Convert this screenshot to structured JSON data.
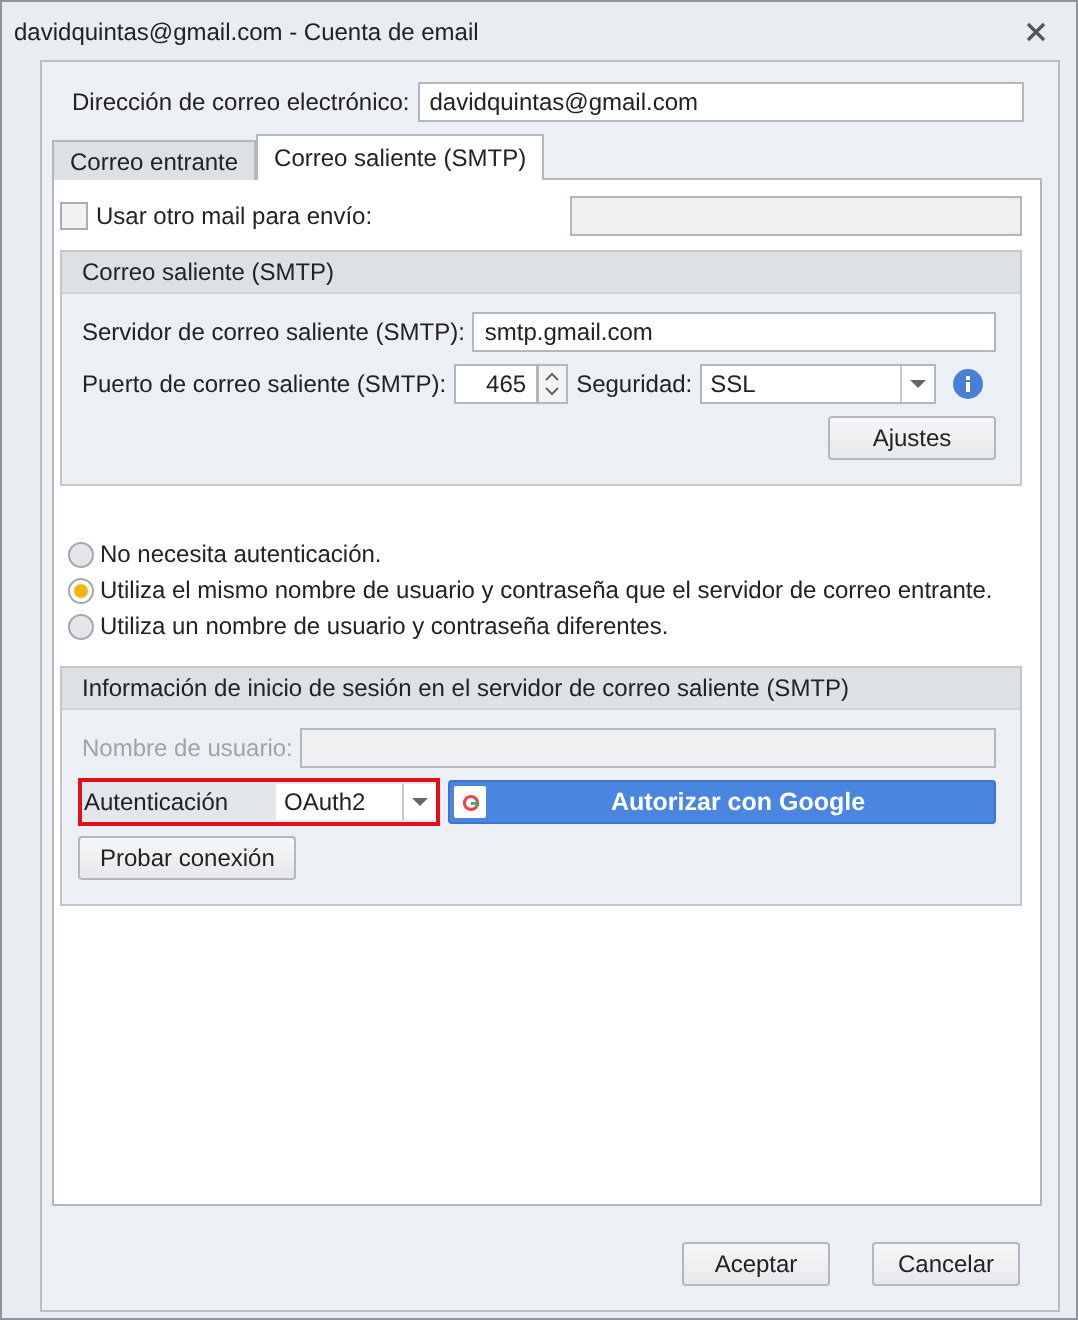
{
  "window": {
    "title": "davidquintas@gmail.com - Cuenta de email"
  },
  "email": {
    "label": "Dirección de correo electrónico:",
    "value": "davidquintas@gmail.com"
  },
  "tabs": [
    {
      "label": "Correo entrante",
      "selected": false
    },
    {
      "label": "Correo saliente (SMTP)",
      "selected": true
    }
  ],
  "alt_mail": {
    "label": "Usar otro mail para envío:",
    "checked": false,
    "disabled": true
  },
  "smtp_group": {
    "title": "Correo saliente (SMTP)",
    "server_label": "Servidor de correo saliente (SMTP):",
    "server": "smtp.gmail.com",
    "port_label": "Puerto de correo saliente (SMTP):",
    "port": "465",
    "security_label": "Seguridad:",
    "security": "SSL",
    "settings_button": "Ajustes"
  },
  "auth_options": [
    {
      "label": "No necesita autenticación.",
      "selected": false
    },
    {
      "label": "Utiliza el mismo nombre de usuario y contraseña que el servidor de correo entrante.",
      "selected": true
    },
    {
      "label": "Utiliza un nombre de usuario y contraseña diferentes.",
      "selected": false
    }
  ],
  "login_group": {
    "title": "Información de inicio de sesión en el servidor de correo saliente (SMTP)",
    "user_label": "Nombre de usuario:",
    "user_disabled": true,
    "auth_label": "Autenticación",
    "auth_value": "OAuth2",
    "auth_highlighted": true,
    "google_button": "Autorizar con Google",
    "test_button": "Probar conexión"
  },
  "buttons": [
    "Aceptar",
    "Cancelar"
  ]
}
